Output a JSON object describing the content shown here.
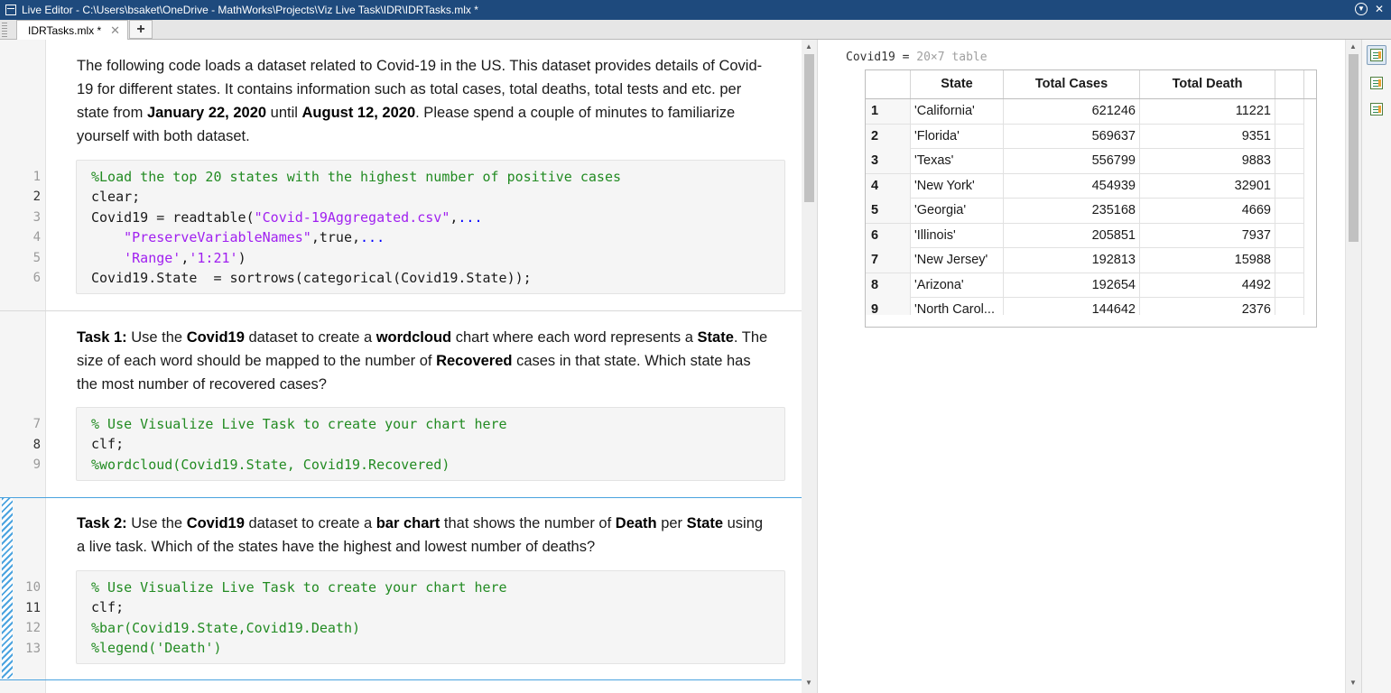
{
  "window": {
    "title": "Live Editor - C:\\Users\\bsaket\\OneDrive - MathWorks\\Projects\\Viz Live Task\\IDR\\IDRTasks.mlx *",
    "help_icon": "help-circle-icon",
    "close_glyph": "✕"
  },
  "tabs": [
    {
      "label": "IDRTasks.mlx *",
      "close": "✕"
    }
  ],
  "tab_add": "+",
  "intro": {
    "p1": "The following code loads a dataset related to Covid-19 in the US. This dataset provides details of Covid-19 for different states. It contains information such as total cases, total deaths, total tests and etc. per state from ",
    "b1": "January 22, 2020",
    "p2": " until ",
    "b2": "August 12, 2020",
    "p3": ". Please spend a couple of minutes to familiarize yourself with both dataset."
  },
  "code1": {
    "line_numbers": [
      "1",
      "2",
      "3",
      "4",
      "5",
      "6"
    ],
    "l1": "%Load the top 20 states with the highest number of positive cases",
    "l2": "clear;",
    "l3_a": "Covid19 = readtable(",
    "l3_str": "\"Covid-19Aggregated.csv\"",
    "l3_b": ",",
    "l3_cont": "...",
    "l4_str": "\"PreserveVariableNames\"",
    "l4_b": ",true,",
    "l4_cont": "...",
    "l5_str1": "'Range'",
    "l5_b": ",",
    "l5_str2": "'1:21'",
    "l5_c": ")",
    "l6": "Covid19.State  = sortrows(categorical(Covid19.State));"
  },
  "task1": {
    "t1": "Task 1:",
    "p1": " Use the ",
    "b1": "Covid19",
    "p2": " dataset to create a ",
    "b2": "wordcloud",
    "p3": " chart where each word represents a ",
    "b3": "State",
    "p4": ". The size of each word should be mapped to the number of ",
    "b4": "Recovered",
    "p5": " cases in that state. Which state has the most number of recovered cases?"
  },
  "code2": {
    "line_numbers": [
      "7",
      "8",
      "9"
    ],
    "l1": "% Use Visualize Live Task to create your chart here",
    "l2": "clf;",
    "l3": "%wordcloud(Covid19.State, Covid19.Recovered)"
  },
  "task2": {
    "t1": "Task 2:",
    "p1": " Use the ",
    "b1": "Covid19",
    "p2": " dataset to create a ",
    "b2": "bar chart",
    "p3": " that shows the number of ",
    "b3": "Death",
    "p4": " per ",
    "b4": "State",
    "p5": " using a live task. Which of the states have the highest and lowest number of deaths?"
  },
  "code3": {
    "line_numbers": [
      "10",
      "11",
      "12",
      "13"
    ],
    "l1": "% Use Visualize Live Task to create your chart here",
    "l2": "clf;",
    "l3": "%bar(Covid19.State,Covid19.Death)",
    "l4": "%legend('Death')"
  },
  "output": {
    "var_name": "Covid19 = ",
    "var_size": "20×7 table",
    "headers": [
      "State",
      "Total Cases",
      "Total Death"
    ],
    "rows": [
      {
        "idx": "1",
        "state": "'California'",
        "cases": "621246",
        "death": "11221"
      },
      {
        "idx": "2",
        "state": "'Florida'",
        "cases": "569637",
        "death": "9351"
      },
      {
        "idx": "3",
        "state": "'Texas'",
        "cases": "556799",
        "death": "9883"
      },
      {
        "idx": "4",
        "state": "'New York'",
        "cases": "454939",
        "death": "32901"
      },
      {
        "idx": "5",
        "state": "'Georgia'",
        "cases": "235168",
        "death": "4669"
      },
      {
        "idx": "6",
        "state": "'Illinois'",
        "cases": "205851",
        "death": "7937"
      },
      {
        "idx": "7",
        "state": "'New Jersey'",
        "cases": "192813",
        "death": "15988"
      },
      {
        "idx": "8",
        "state": "'Arizona'",
        "cases": "192654",
        "death": "4492"
      },
      {
        "idx": "9",
        "state": "'North Carol...",
        "cases": "144642",
        "death": "2376"
      }
    ]
  },
  "colors": {
    "titlebar": "#1e4a7d",
    "comment": "#228b22",
    "string": "#a020f0",
    "continuation": "#0000ff",
    "section_active": "#4aa3df"
  },
  "toolbar_icons": [
    "output-inline-icon",
    "output-right-icon",
    "hide-code-icon"
  ]
}
